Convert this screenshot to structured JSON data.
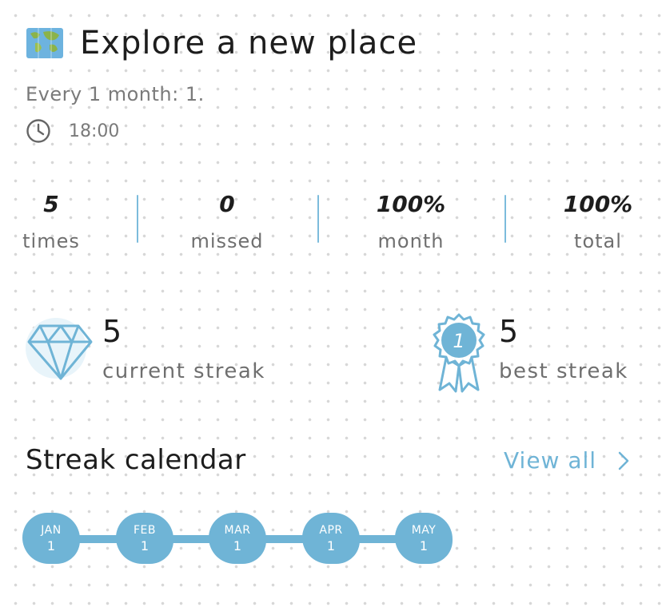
{
  "header": {
    "title": "Explore a new place",
    "icon": "world-map-icon",
    "frequency": "Every 1 month: 1.",
    "time": "18:00"
  },
  "stats": [
    {
      "value": "5",
      "label": "times"
    },
    {
      "value": "0",
      "label": "missed"
    },
    {
      "value": "100%",
      "label": "month"
    },
    {
      "value": "100%",
      "label": "total"
    }
  ],
  "streaks": {
    "current": {
      "value": "5",
      "label": "current streak",
      "icon": "diamond-icon"
    },
    "best": {
      "value": "5",
      "label": "best streak",
      "icon": "award-ribbon-icon",
      "badge": "1"
    }
  },
  "calendar": {
    "title": "Streak calendar",
    "view_all": "View all",
    "months": [
      {
        "month": "JAN",
        "count": "1"
      },
      {
        "month": "FEB",
        "count": "1"
      },
      {
        "month": "MAR",
        "count": "1"
      },
      {
        "month": "APR",
        "count": "1"
      },
      {
        "month": "MAY",
        "count": "1"
      }
    ]
  },
  "colors": {
    "accent": "#6fb4d6",
    "text": "#1d1d1d",
    "muted": "#7a7a7a"
  }
}
